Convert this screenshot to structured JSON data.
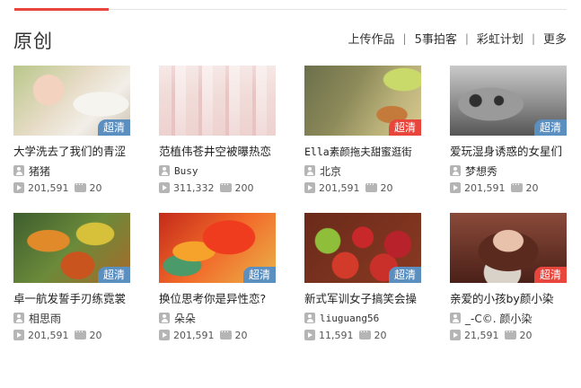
{
  "section": {
    "title": "原创",
    "nav": [
      {
        "label": "上传作品"
      },
      {
        "label": "5事拍客"
      },
      {
        "label": "彩虹计划"
      },
      {
        "label": "更多"
      }
    ]
  },
  "videos": [
    {
      "title": "大学洗去了我们的青涩",
      "user": "猪猪",
      "plays": "201,591",
      "comments": "20",
      "badge": "超清",
      "badge_color": "#5b8fbf"
    },
    {
      "title": "范植伟苍井空被曝热恋",
      "user": "Busy",
      "plays": "311,332",
      "comments": "200",
      "badge": "",
      "badge_color": ""
    },
    {
      "title": "Ella素颜拖夫甜蜜逛街",
      "user": "北京",
      "plays": "201,591",
      "comments": "20",
      "badge": "超清",
      "badge_color": "#e8463c"
    },
    {
      "title": "爱玩湿身诱惑的女星们",
      "user": "梦想秀",
      "plays": "201,591",
      "comments": "20",
      "badge": "超清",
      "badge_color": "#5b8fbf"
    },
    {
      "title": "卓一航发誓手刃练霓裳",
      "user": "相思雨",
      "plays": "201,591",
      "comments": "20",
      "badge": "超清",
      "badge_color": "#5b8fbf"
    },
    {
      "title": "换位思考你是异性恋?",
      "user": "朵朵",
      "plays": "201,591",
      "comments": "20",
      "badge": "超清",
      "badge_color": "#5b8fbf"
    },
    {
      "title": "新式军训女子搞笑会操",
      "user": "liuguang56",
      "plays": "11,591",
      "comments": "20",
      "badge": "超清",
      "badge_color": "#5b8fbf"
    },
    {
      "title": "亲爱的小孩by颜小染",
      "user": "_-C©. 颜小染",
      "plays": "21,591",
      "comments": "20",
      "badge": "超清",
      "badge_color": "#e8463c"
    }
  ]
}
